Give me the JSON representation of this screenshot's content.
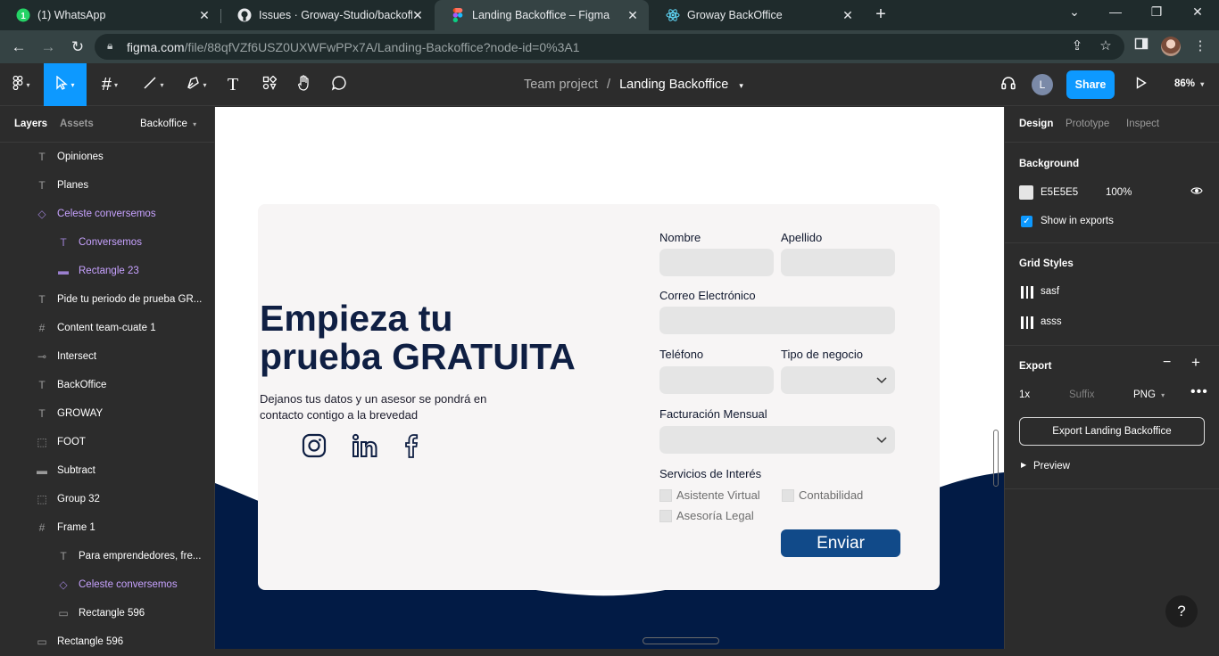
{
  "browser": {
    "tabs": [
      {
        "title": "(1) WhatsApp",
        "icon": "whatsapp-icon"
      },
      {
        "title": "Issues · Groway-Studio/backoffice",
        "icon": "github-icon"
      },
      {
        "title": "Landing Backoffice – Figma",
        "icon": "figma-icon"
      },
      {
        "title": "Groway BackOffice",
        "icon": "react-icon"
      }
    ],
    "url_host": "figma.com",
    "url_path": "/file/88qfVZf6USZ0UXWFwPPx7A/Landing-Backoffice?node-id=0%3A1"
  },
  "figma": {
    "breadcrumb_team": "Team project",
    "breadcrumb_sep": "/",
    "file_name": "Landing Backoffice",
    "avatar_initial": "L",
    "share_label": "Share",
    "zoom": "86%"
  },
  "left_panel": {
    "tab_layers": "Layers",
    "tab_assets": "Assets",
    "page": "Backoffice",
    "layers": [
      {
        "name": "Opiniones",
        "icon": "T",
        "indent": 1,
        "component": false
      },
      {
        "name": "Planes",
        "icon": "T",
        "indent": 1,
        "component": false
      },
      {
        "name": "Celeste conversemos",
        "icon": "◇",
        "indent": 1,
        "component": true
      },
      {
        "name": "Conversemos",
        "icon": "T",
        "indent": 2,
        "component": true
      },
      {
        "name": "Rectangle 23",
        "icon": "▬",
        "indent": 2,
        "component": true
      },
      {
        "name": "Pide tu periodo de prueba GR...",
        "icon": "T",
        "indent": 1,
        "component": false
      },
      {
        "name": "Content team-cuate 1",
        "icon": "#",
        "indent": 1,
        "component": false
      },
      {
        "name": "Intersect",
        "icon": "⊸",
        "indent": 1,
        "component": false
      },
      {
        "name": "BackOffice",
        "icon": "T",
        "indent": 1,
        "component": false
      },
      {
        "name": "GROWAY",
        "icon": "T",
        "indent": 1,
        "component": false
      },
      {
        "name": "FOOT",
        "icon": "⬚",
        "indent": 1,
        "component": false
      },
      {
        "name": "Subtract",
        "icon": "▬",
        "indent": 1,
        "component": false
      },
      {
        "name": "Group 32",
        "icon": "⬚",
        "indent": 1,
        "component": false
      },
      {
        "name": "Frame 1",
        "icon": "#",
        "indent": 1,
        "component": false
      },
      {
        "name": "Para emprendedores, fre...",
        "icon": "T",
        "indent": 2,
        "component": false
      },
      {
        "name": "Celeste conversemos",
        "icon": "◇",
        "indent": 2,
        "component": true
      },
      {
        "name": "Rectangle 596",
        "icon": "▭",
        "indent": 2,
        "component": false
      },
      {
        "name": "Rectangle 596",
        "icon": "▭",
        "indent": 1,
        "component": false
      }
    ]
  },
  "canvas": {
    "hero_line1": "Empieza tu",
    "hero_line2": "prueba GRATUITA",
    "hero_sub": "Dejanos tus datos y  un asesor se pondrá en contacto contigo a la brevedad",
    "social_icons": [
      "instagram-icon",
      "linkedin-icon",
      "facebook-icon"
    ],
    "form": {
      "nombre": "Nombre",
      "apellido": "Apellido",
      "correo": "Correo Electrónico",
      "telefono": "Teléfono",
      "tipo_negocio": "Tipo de negocio",
      "facturacion": "Facturación Mensual",
      "servicios": "Servicios de Interés",
      "opt_asistente": "Asistente Virtual",
      "opt_contabilidad": "Contabilidad",
      "opt_asesoria": "Asesoría Legal",
      "send": "Enviar"
    },
    "colors": {
      "navy": "#0f1f43",
      "button": "#114a89",
      "input": "#e5e5e5",
      "card": "#f7f5f5"
    }
  },
  "right_panel": {
    "tab_design": "Design",
    "tab_prototype": "Prototype",
    "tab_inspect": "Inspect",
    "background_title": "Background",
    "background_hex": "E5E5E5",
    "background_opacity": "100%",
    "show_in_exports": "Show in exports",
    "grid_title": "Grid Styles",
    "grid_styles": [
      "sasf",
      "asss"
    ],
    "export_title": "Export",
    "export_scale": "1x",
    "export_suffix": "Suffix",
    "export_format": "PNG",
    "export_button": "Export Landing Backoffice",
    "preview": "Preview"
  },
  "help": "?"
}
